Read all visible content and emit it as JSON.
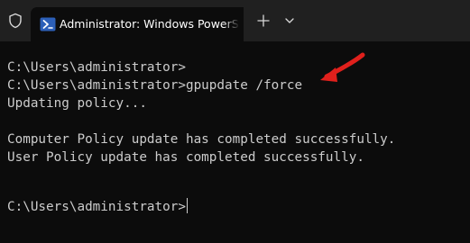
{
  "window": {
    "tab_title": "Administrator: Windows PowerShell"
  },
  "icons": {
    "shield": "shield-icon",
    "tab": "powershell-icon",
    "new_tab": "plus-icon",
    "dropdown": "chevron-down-icon",
    "annotation": "red-arrow-icon"
  },
  "colors": {
    "background": "#0c0c0c",
    "titlebar": "#202020",
    "text": "#cccccc",
    "powershell_blue": "#2c5fb8",
    "annotation_red": "#e0201c"
  },
  "terminal": {
    "lines": [
      "C:\\Users\\administrator>",
      "C:\\Users\\administrator>gpupdate /force",
      "Updating policy...",
      "",
      "Computer Policy update has completed successfully.",
      "User Policy update has completed successfully.",
      "",
      "",
      "C:\\Users\\administrator>"
    ]
  }
}
